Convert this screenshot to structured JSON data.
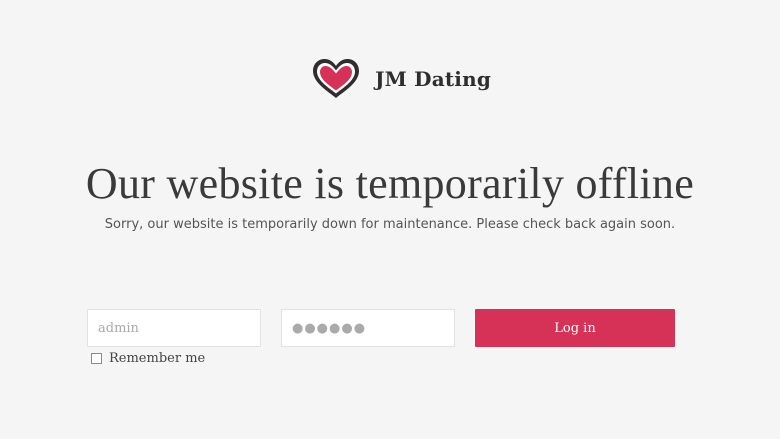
{
  "brand": {
    "name": "JM Dating",
    "logo_icon": "heart-icon",
    "logo_color": "#d63257"
  },
  "main": {
    "headline": "Our website is temporarily offline",
    "subtext": "Sorry, our website is temporarily down for maintenance. Please check back again soon."
  },
  "login": {
    "username_placeholder": "admin",
    "password_placeholder": "●●●●●●",
    "button_label": "Log in",
    "remember_label": "Remember me",
    "remember_checked": false,
    "button_color": "#d63257"
  }
}
